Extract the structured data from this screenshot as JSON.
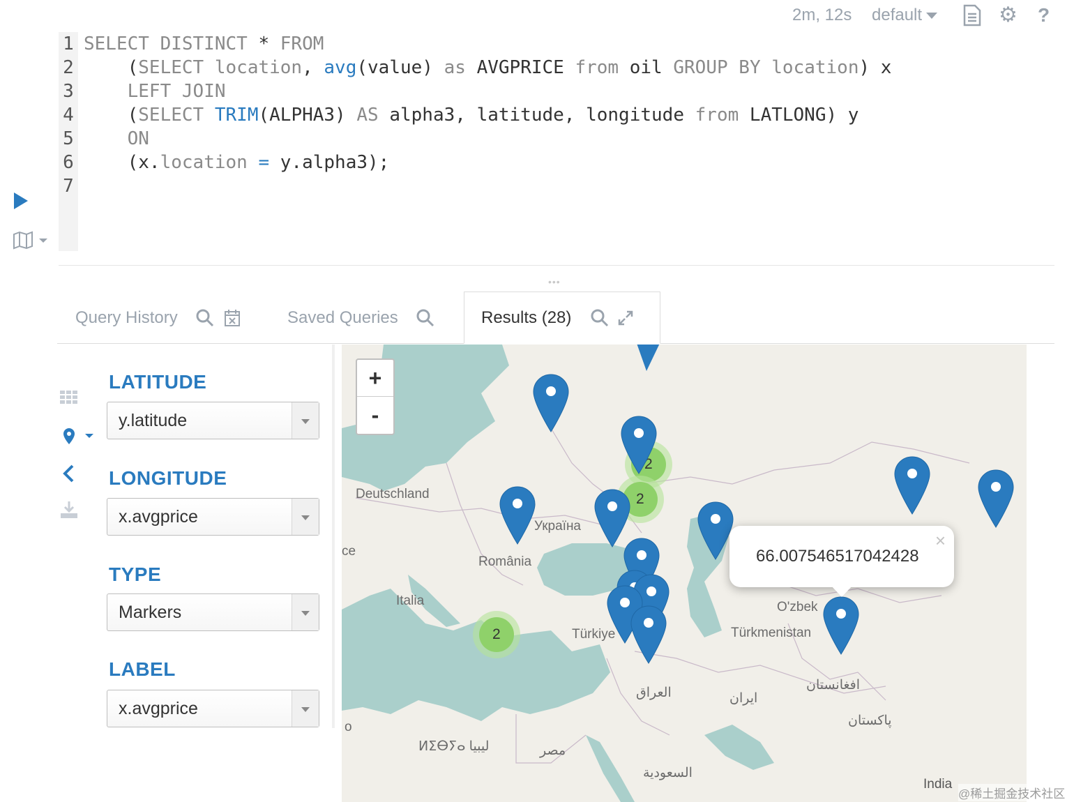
{
  "header": {
    "execution_time": "2m, 12s",
    "database": "default",
    "icons": [
      "document-icon",
      "gear-icon",
      "help-icon"
    ]
  },
  "editor": {
    "line_numbers": [
      "1",
      "2",
      "3",
      "4",
      "5",
      "6",
      "7"
    ],
    "lines": [
      [
        {
          "t": "SELECT DISTINCT",
          "c": "kw"
        },
        {
          "t": " * ",
          "c": ""
        },
        {
          "t": "FROM",
          "c": "kw"
        }
      ],
      [
        {
          "t": "    (",
          "c": ""
        },
        {
          "t": "SELECT",
          "c": "kw"
        },
        {
          "t": " ",
          "c": ""
        },
        {
          "t": "location",
          "c": "kw"
        },
        {
          "t": ", ",
          "c": ""
        },
        {
          "t": "avg",
          "c": "fn"
        },
        {
          "t": "(value) ",
          "c": ""
        },
        {
          "t": "as",
          "c": "kw"
        },
        {
          "t": " AVGPRICE ",
          "c": ""
        },
        {
          "t": "from",
          "c": "kw"
        },
        {
          "t": " oil ",
          "c": ""
        },
        {
          "t": "GROUP BY",
          "c": "kw"
        },
        {
          "t": " ",
          "c": ""
        },
        {
          "t": "location",
          "c": "kw"
        },
        {
          "t": ") x",
          "c": ""
        }
      ],
      [
        {
          "t": "    ",
          "c": ""
        },
        {
          "t": "LEFT JOIN",
          "c": "kw"
        }
      ],
      [
        {
          "t": "    (",
          "c": ""
        },
        {
          "t": "SELECT",
          "c": "kw"
        },
        {
          "t": " ",
          "c": ""
        },
        {
          "t": "TRIM",
          "c": "fn"
        },
        {
          "t": "(ALPHA3) ",
          "c": ""
        },
        {
          "t": "AS",
          "c": "kw"
        },
        {
          "t": " alpha3, latitude, longitude ",
          "c": ""
        },
        {
          "t": "from",
          "c": "kw"
        },
        {
          "t": " LATLONG) y",
          "c": ""
        }
      ],
      [
        {
          "t": "    ",
          "c": ""
        },
        {
          "t": "ON",
          "c": "kw"
        }
      ],
      [
        {
          "t": "    (x.",
          "c": ""
        },
        {
          "t": "location",
          "c": "kw"
        },
        {
          "t": " ",
          "c": ""
        },
        {
          "t": "=",
          "c": "fn"
        },
        {
          "t": " y.alpha3);",
          "c": ""
        }
      ],
      []
    ]
  },
  "tabs": [
    {
      "label": "Query History",
      "icons": [
        "search-icon",
        "calendar-clear-icon"
      ]
    },
    {
      "label": "Saved Queries",
      "icons": [
        "search-icon"
      ]
    },
    {
      "label": "Results (28)",
      "icons": [
        "search-icon",
        "expand-icon"
      ],
      "active": true
    }
  ],
  "settings": {
    "latitude": {
      "label": "LATITUDE",
      "value": "y.latitude"
    },
    "longitude": {
      "label": "LONGITUDE",
      "value": "x.avgprice"
    },
    "type": {
      "label": "TYPE",
      "value": "Markers"
    },
    "label": {
      "label": "LABEL",
      "value": "x.avgprice"
    }
  },
  "map": {
    "zoom_in": "+",
    "zoom_out": "-",
    "labels": [
      "Deutschland",
      "Україна",
      "România",
      "Italia",
      "Türkiye",
      "O'zbek",
      "Türkmenistan",
      "العراق",
      "ایران",
      "افغانستان",
      "پاکستان",
      "ⵍⵉⴱⵢⴰ ليبيا",
      "مصر",
      "السعودية",
      "ce",
      "o"
    ],
    "clusters": [
      "2",
      "2",
      "2"
    ],
    "popup_value": "66.007546517042428",
    "attribution": "India",
    "watermark": "@稀土掘金技术社区",
    "colors": {
      "marker": "#2a7bbf",
      "cluster": "#8fd16a",
      "water": "#aacfcb",
      "land": "#f1efe9"
    }
  }
}
